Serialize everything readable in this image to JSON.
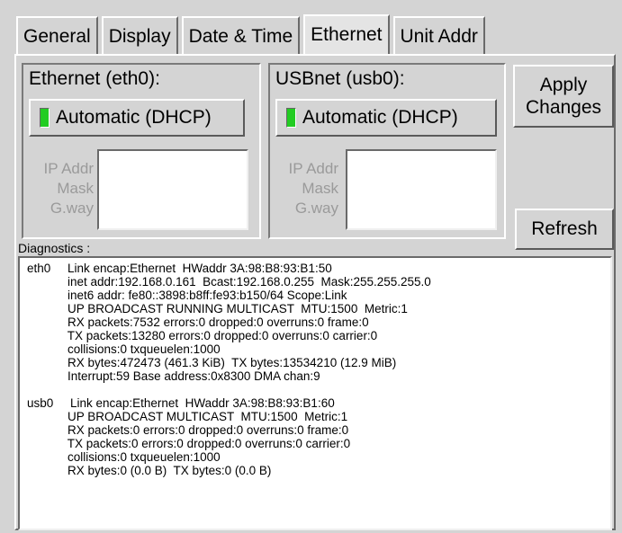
{
  "tabs": [
    {
      "label": "General"
    },
    {
      "label": "Display"
    },
    {
      "label": "Date & Time"
    },
    {
      "label": "Ethernet"
    },
    {
      "label": "Unit Addr"
    }
  ],
  "eth0": {
    "title": "Ethernet (eth0):",
    "mode_button": "Automatic (DHCP)",
    "ip_label": "IP Addr",
    "mask_label": "Mask",
    "gateway_label": "G.way"
  },
  "usb0": {
    "title": "USBnet (usb0):",
    "mode_button": "Automatic (DHCP)",
    "ip_label": "IP Addr",
    "mask_label": "Mask",
    "gateway_label": "G.way"
  },
  "buttons": {
    "apply_line1": "Apply",
    "apply_line2": "Changes",
    "refresh": "Refresh"
  },
  "diagnostics": {
    "label": "Diagnostics :",
    "lines": [
      "eth0     Link encap:Ethernet  HWaddr 3A:98:B8:93:B1:50",
      "            inet addr:192.168.0.161  Bcast:192.168.0.255  Mask:255.255.255.0",
      "            inet6 addr: fe80::3898:b8ff:fe93:b150/64 Scope:Link",
      "            UP BROADCAST RUNNING MULTICAST  MTU:1500  Metric:1",
      "            RX packets:7532 errors:0 dropped:0 overruns:0 frame:0",
      "            TX packets:13280 errors:0 dropped:0 overruns:0 carrier:0",
      "            collisions:0 txqueuelen:1000",
      "            RX bytes:472473 (461.3 KiB)  TX bytes:13534210 (12.9 MiB)",
      "            Interrupt:59 Base address:0x8300 DMA chan:9",
      "",
      "usb0     Link encap:Ethernet  HWaddr 3A:98:B8:93:B1:60",
      "            UP BROADCAST MULTICAST  MTU:1500  Metric:1",
      "            RX packets:0 errors:0 dropped:0 overruns:0 frame:0",
      "            TX packets:0 errors:0 dropped:0 overruns:0 carrier:0",
      "            collisions:0 txqueuelen:1000",
      "            RX bytes:0 (0.0 B)  TX bytes:0 (0.0 B)"
    ]
  },
  "colors": {
    "background": "#d4d4d4",
    "led_on": "#22cc22",
    "disabled_text": "#9a9a9a"
  }
}
